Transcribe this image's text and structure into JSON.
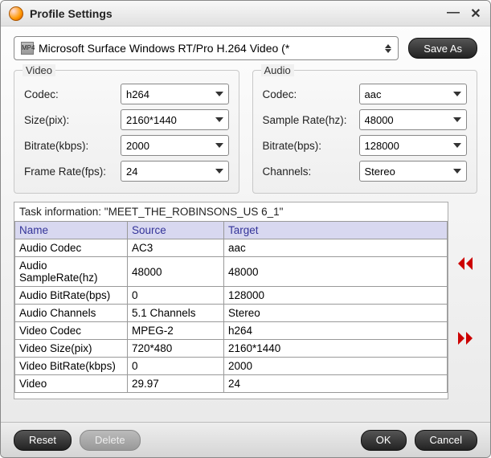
{
  "window": {
    "title": "Profile Settings"
  },
  "profile": {
    "selected": "Microsoft Surface Windows RT/Pro H.264 Video (*",
    "save_as": "Save As"
  },
  "video": {
    "panel_title": "Video",
    "labels": {
      "codec": "Codec:",
      "size": "Size(pix):",
      "bitrate": "Bitrate(kbps):",
      "fps": "Frame Rate(fps):"
    },
    "values": {
      "codec": "h264",
      "size": "2160*1440",
      "bitrate": "2000",
      "fps": "24"
    }
  },
  "audio": {
    "panel_title": "Audio",
    "labels": {
      "codec": "Codec:",
      "sample": "Sample Rate(hz):",
      "bitrate": "Bitrate(bps):",
      "channels": "Channels:"
    },
    "values": {
      "codec": "aac",
      "sample": "48000",
      "bitrate": "128000",
      "channels": "Stereo"
    }
  },
  "task": {
    "info_label": "Task information: \"MEET_THE_ROBINSONS_US 6_1\"",
    "headers": {
      "name": "Name",
      "source": "Source",
      "target": "Target"
    },
    "rows": [
      {
        "name": "Audio Codec",
        "source": "AC3",
        "target": "aac"
      },
      {
        "name": "Audio SampleRate(hz)",
        "source": "48000",
        "target": "48000"
      },
      {
        "name": "Audio BitRate(bps)",
        "source": "0",
        "target": "128000"
      },
      {
        "name": "Audio Channels",
        "source": "5.1 Channels",
        "target": "Stereo"
      },
      {
        "name": "Video Codec",
        "source": "MPEG-2",
        "target": "h264"
      },
      {
        "name": "Video Size(pix)",
        "source": "720*480",
        "target": "2160*1440"
      },
      {
        "name": "Video BitRate(kbps)",
        "source": "0",
        "target": "2000"
      },
      {
        "name": "Video",
        "source": "29.97",
        "target": "24"
      }
    ]
  },
  "footer": {
    "reset": "Reset",
    "delete": "Delete",
    "ok": "OK",
    "cancel": "Cancel"
  },
  "chart_data": {
    "type": "table",
    "title": "Task information: \"MEET_THE_ROBINSONS_US 6_1\"",
    "columns": [
      "Name",
      "Source",
      "Target"
    ],
    "rows": [
      [
        "Audio Codec",
        "AC3",
        "aac"
      ],
      [
        "Audio SampleRate(hz)",
        "48000",
        "48000"
      ],
      [
        "Audio BitRate(bps)",
        "0",
        "128000"
      ],
      [
        "Audio Channels",
        "5.1 Channels",
        "Stereo"
      ],
      [
        "Video Codec",
        "MPEG-2",
        "h264"
      ],
      [
        "Video Size(pix)",
        "720*480",
        "2160*1440"
      ],
      [
        "Video BitRate(kbps)",
        "0",
        "2000"
      ],
      [
        "Video",
        "29.97",
        "24"
      ]
    ]
  }
}
